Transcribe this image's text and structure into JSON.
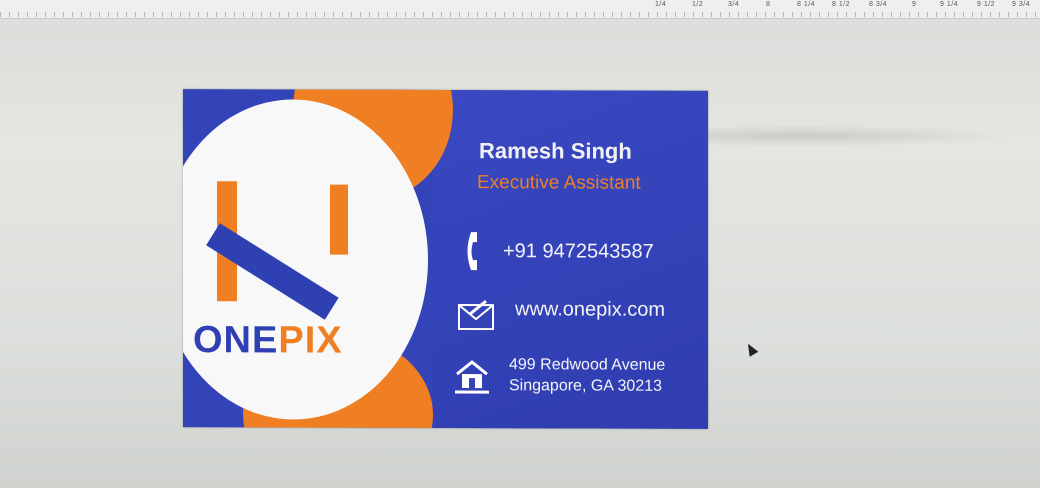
{
  "ruler": {
    "labels": [
      "1/4",
      "1/2",
      "3/4",
      "8",
      "8 1/4",
      "8 1/2",
      "8 3/4",
      "9",
      "9 1/4",
      "9 1/2",
      "9 3/4"
    ]
  },
  "card": {
    "brand_part1": "ONE",
    "brand_part2": "PIX",
    "name": "Ramesh Singh",
    "title": "Executive Assistant",
    "phone": "+91 9472543587",
    "website": "www.onepix.com",
    "address_line1": "499 Redwood Avenue",
    "address_line2": "Singapore, GA 30213",
    "colors": {
      "blue": "#3343b8",
      "orange": "#ef7f22",
      "white": "#f8f8f8"
    },
    "icons": [
      "phone-icon",
      "mail-icon",
      "home-icon"
    ]
  }
}
